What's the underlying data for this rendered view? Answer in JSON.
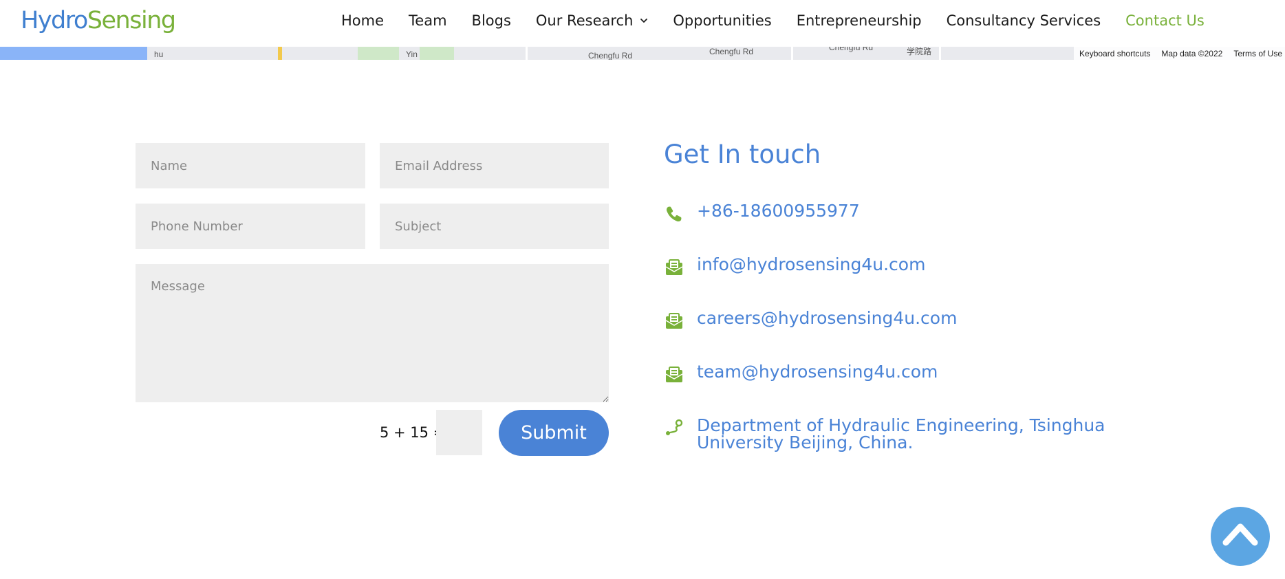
{
  "logo": {
    "part1": "Hydro",
    "part2": "Sensing"
  },
  "nav": {
    "items": [
      {
        "label": "Home"
      },
      {
        "label": "Team"
      },
      {
        "label": "Blogs"
      },
      {
        "label": "Our Research"
      },
      {
        "label": "Opportunities"
      },
      {
        "label": "Entrepreneurship"
      },
      {
        "label": "Consultancy Services"
      },
      {
        "label": "Contact Us"
      }
    ],
    "dropdown_icon": "chevron-down-icon"
  },
  "map": {
    "road_labels": [
      "hu",
      "Yin",
      "Chengfu Rd",
      "Chengfu Rd",
      "Chengfu Rd",
      "学院路"
    ],
    "attribution": {
      "shortcuts": "Keyboard shortcuts",
      "data": "Map data ©2022",
      "terms": "Terms of Use"
    }
  },
  "form": {
    "name_placeholder": "Name",
    "email_placeholder": "Email Address",
    "phone_placeholder": "Phone Number",
    "subject_placeholder": "Subject",
    "message_placeholder": "Message",
    "captcha_question": "5 + 15 =",
    "submit_label": "Submit"
  },
  "contact": {
    "title": "Get In touch",
    "phone": "+86-18600955977",
    "emails": [
      "info@hydrosensing4u.com",
      "careers@hydrosensing4u.com",
      "team@hydrosensing4u.com"
    ],
    "address": "Department of Hydraulic Engineering, Tsinghua University Beijing, China.",
    "icons": [
      "phone-icon",
      "email-icon",
      "email-icon",
      "email-icon",
      "location-route-icon"
    ]
  },
  "colors": {
    "brand_blue": "#4a83d6",
    "brand_green": "#79b13a",
    "field_bg": "#eeeeee",
    "scroll_top_bg": "#5ca6e3"
  },
  "scroll_top_icon": "chevron-up-icon"
}
